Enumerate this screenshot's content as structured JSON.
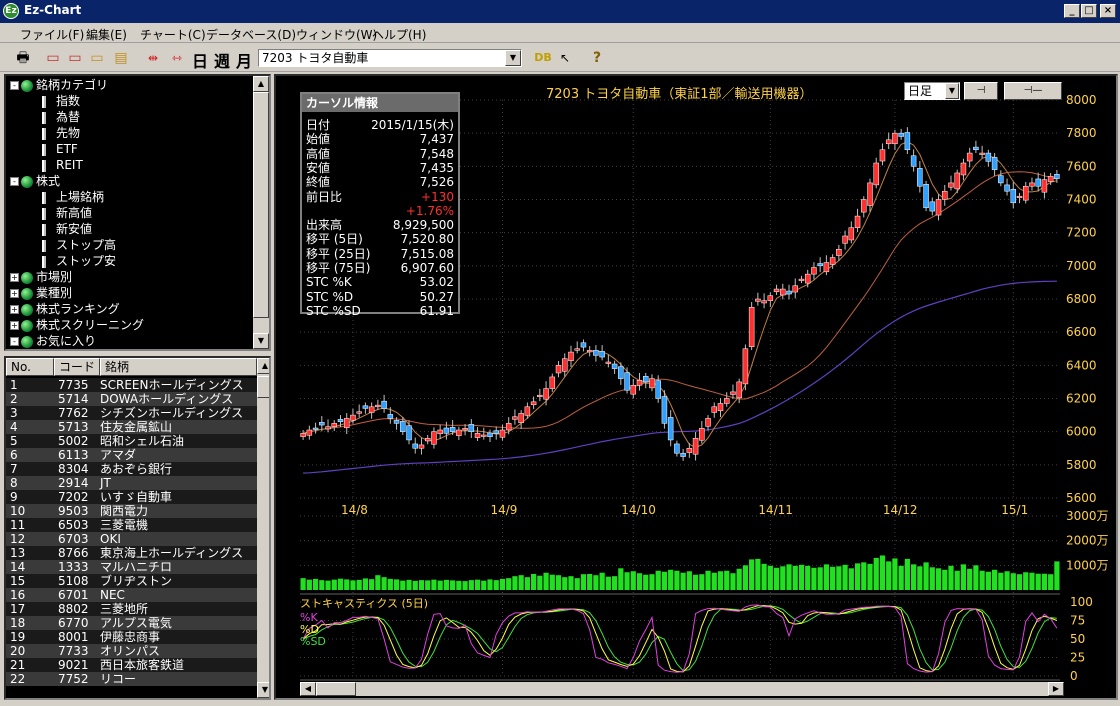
{
  "window": {
    "title": "Ez-Chart",
    "icon_letter": "Ez",
    "minimize": "_",
    "maximize": "□",
    "close": "×"
  },
  "menu": [
    "ファイル(F)",
    "編集(E)",
    "チャート(C)",
    "データベース(D)",
    "ウィンドウ(W)",
    "ヘルプ(H)"
  ],
  "toolbar": {
    "kanji_buttons": [
      "日",
      "週",
      "月"
    ],
    "stock_combo_value": "7203 トヨタ自動車",
    "icons": [
      "print-icon",
      "new-doc-icon",
      "copy-doc-icon",
      "paste-doc-icon",
      "notes-icon",
      "shrink-chart-icon",
      "expand-chart-icon",
      "db-icon",
      "pointer-help-icon",
      "help-icon"
    ]
  },
  "tree": [
    {
      "label": "銘柄カテゴリ",
      "level": 0,
      "expander": "-",
      "icon": "globe-icon"
    },
    {
      "label": "指数",
      "level": 1,
      "icon": "doc-icon"
    },
    {
      "label": "為替",
      "level": 1,
      "icon": "doc-icon"
    },
    {
      "label": "先物",
      "level": 1,
      "icon": "doc-icon"
    },
    {
      "label": "ETF",
      "level": 1,
      "icon": "doc-icon"
    },
    {
      "label": "REIT",
      "level": 1,
      "icon": "doc-icon"
    },
    {
      "label": "株式",
      "level": 0,
      "expander": "-",
      "icon": "globe-icon"
    },
    {
      "label": "上場銘柄",
      "level": 1,
      "icon": "doc-icon"
    },
    {
      "label": "新高値",
      "level": 1,
      "icon": "doc-icon"
    },
    {
      "label": "新安値",
      "level": 1,
      "icon": "doc-icon"
    },
    {
      "label": "ストップ高",
      "level": 1,
      "icon": "doc-icon"
    },
    {
      "label": "ストップ安",
      "level": 1,
      "icon": "doc-icon"
    },
    {
      "label": "市場別",
      "level": 0,
      "expander": "+",
      "icon": "globe-icon"
    },
    {
      "label": "業種別",
      "level": 0,
      "expander": "+",
      "icon": "globe-icon"
    },
    {
      "label": "株式ランキング",
      "level": 0,
      "expander": "+",
      "icon": "globe-icon"
    },
    {
      "label": "株式スクリーニング",
      "level": 0,
      "expander": "+",
      "icon": "globe-icon"
    },
    {
      "label": "お気に入り",
      "level": 0,
      "expander": "-",
      "icon": "globe-icon"
    }
  ],
  "list": {
    "headers": [
      "No.",
      "コード",
      "銘柄"
    ],
    "rows": [
      [
        "1",
        "7735",
        "SCREENホールディングス"
      ],
      [
        "2",
        "5714",
        "DOWAホールディングス"
      ],
      [
        "3",
        "7762",
        "シチズンホールディングス"
      ],
      [
        "4",
        "5713",
        "住友金属鉱山"
      ],
      [
        "5",
        "5002",
        "昭和シェル石油"
      ],
      [
        "6",
        "6113",
        "アマダ"
      ],
      [
        "7",
        "8304",
        "あおぞら銀行"
      ],
      [
        "8",
        "2914",
        "JT"
      ],
      [
        "9",
        "7202",
        "いすゞ自動車"
      ],
      [
        "10",
        "9503",
        "関西電力"
      ],
      [
        "11",
        "6503",
        "三菱電機"
      ],
      [
        "12",
        "6703",
        "OKI"
      ],
      [
        "13",
        "8766",
        "東京海上ホールディングス"
      ],
      [
        "14",
        "1333",
        "マルハニチロ"
      ],
      [
        "15",
        "5108",
        "ブリヂストン"
      ],
      [
        "16",
        "6701",
        "NEC"
      ],
      [
        "17",
        "8802",
        "三菱地所"
      ],
      [
        "18",
        "6770",
        "アルプス電気"
      ],
      [
        "19",
        "8001",
        "伊藤忠商事"
      ],
      [
        "20",
        "7733",
        "オリンパス"
      ],
      [
        "21",
        "9021",
        "西日本旅客鉄道"
      ],
      [
        "22",
        "7752",
        "リコー"
      ]
    ]
  },
  "chart": {
    "title": "7203 トヨタ自動車（東証1部／輸送用機器）",
    "period": "日足",
    "zoom_out_label": "⊣",
    "zoom_in_label": "⊣—",
    "price_ticks": [
      "8000",
      "7800",
      "7600",
      "7400",
      "7200",
      "7000",
      "6800",
      "6600",
      "6400",
      "6200",
      "6000",
      "5800",
      "5600"
    ],
    "date_ticks": [
      "14/8",
      "14/9",
      "14/10",
      "14/11",
      "14/12",
      "15/1"
    ],
    "volume_ticks": [
      "3000万",
      "2000万",
      "1000万"
    ],
    "stoch_title": "ストキャスティクス (5日)",
    "stoch_legend": [
      "%K",
      "%D",
      "%SD"
    ],
    "stoch_ticks": [
      "100",
      "75",
      "50",
      "25",
      "0"
    ],
    "colors": {
      "up": "#ff3030",
      "down": "#30a0ff",
      "ma_short": "#c08040",
      "ma_mid": "#c06040",
      "ma_long": "#6040c0",
      "volume": "#20e020",
      "k": "#e040e0",
      "d": "#ffff40",
      "sd": "#40e040",
      "grid": "#404040"
    }
  },
  "cursor_info": {
    "title": "カーソル情報",
    "rows": [
      [
        "日付",
        "2015/1/15(木)"
      ],
      [
        "始値",
        "7,437"
      ],
      [
        "高値",
        "7,548"
      ],
      [
        "安値",
        "7,435"
      ],
      [
        "終値",
        "7,526"
      ],
      [
        "前日比",
        "+130"
      ],
      [
        "",
        "+1.76%"
      ],
      [
        "出来高",
        "8,929,500"
      ],
      [
        "移平 (5日)",
        "7,520.80"
      ],
      [
        "移平 (25日)",
        "7,515.08"
      ],
      [
        "移平 (75日)",
        "6,907.60"
      ],
      [
        "STC %K",
        "53.02"
      ],
      [
        "STC %D",
        "50.27"
      ],
      [
        "STC %SD",
        "61.91"
      ]
    ]
  },
  "chart_data": {
    "type": "line",
    "title": "7203 トヨタ自動車（東証1部／輸送用機器）",
    "ylim": [
      5600,
      8000
    ],
    "x_ticks": [
      "14/8",
      "14/9",
      "14/10",
      "14/11",
      "14/12",
      "15/1"
    ],
    "close": [
      5990,
      6010,
      6020,
      6040,
      6030,
      6050,
      6060,
      6080,
      6100,
      6120,
      6140,
      6150,
      6160,
      6140,
      6080,
      6050,
      6000,
      5950,
      5900,
      5920,
      5960,
      6000,
      6010,
      5990,
      6000,
      6010,
      6020,
      6000,
      5990,
      5980,
      5970,
      5990,
      6010,
      6050,
      6090,
      6110,
      6150,
      6180,
      6220,
      6260,
      6330,
      6400,
      6440,
      6480,
      6500,
      6510,
      6490,
      6460,
      6450,
      6420,
      6380,
      6320,
      6250,
      6280,
      6310,
      6300,
      6320,
      6200,
      6050,
      5950,
      5870,
      5850,
      5900,
      5960,
      6020,
      6080,
      6150,
      6170,
      6200,
      6240,
      6300,
      6500,
      6750,
      6800,
      6790,
      6820,
      6860,
      6860,
      6830,
      6880,
      6920,
      6950,
      6990,
      7000,
      7020,
      7050,
      7100,
      7180,
      7230,
      7300,
      7400,
      7500,
      7620,
      7700,
      7760,
      7800,
      7780,
      7700,
      7600,
      7480,
      7350,
      7330,
      7400,
      7450,
      7500,
      7560,
      7620,
      7680,
      7700,
      7680,
      7630,
      7580,
      7500,
      7450,
      7380,
      7420,
      7480,
      7500,
      7480,
      7520,
      7540,
      7526
    ],
    "ma75": [
      5750,
      5752,
      5755,
      5758,
      5762,
      5766,
      5770,
      5774,
      5778,
      5782,
      5786,
      5790,
      5794,
      5798,
      5801,
      5804,
      5806,
      5808,
      5810,
      5811,
      5812,
      5814,
      5816,
      5818,
      5820,
      5822,
      5824,
      5826,
      5828,
      5830,
      5832,
      5834,
      5837,
      5840,
      5844,
      5848,
      5853,
      5858,
      5864,
      5870,
      5877,
      5884,
      5892,
      5900,
      5908,
      5916,
      5924,
      5932,
      5940,
      5947,
      5954,
      5960,
      5966,
      5972,
      5978,
      5984,
      5990,
      5994,
      5996,
      5998,
      6000,
      6001,
      6002,
      6004,
      6007,
      6011,
      6017,
      6024,
      6031,
      6040,
      6050,
      6063,
      6080,
      6098,
      6116,
      6135,
      6155,
      6176,
      6197,
      6220,
      6243,
      6267,
      6292,
      6318,
      6345,
      6373,
      6402,
      6432,
      6463,
      6495,
      6528,
      6560,
      6590,
      6618,
      6644,
      6668,
      6690,
      6710,
      6728,
      6744,
      6758,
      6770,
      6782,
      6793,
      6804,
      6815,
      6826,
      6837,
      6848,
      6859,
      6868,
      6876,
      6883,
      6889,
      6894,
      6898,
      6901,
      6903,
      6905,
      6906,
      6907,
      6907.6
    ],
    "volume_units": "万株",
    "volume": [
      480,
      420,
      450,
      400,
      380,
      420,
      460,
      430,
      390,
      410,
      470,
      440,
      600,
      520,
      450,
      430,
      380,
      410,
      370,
      400,
      390,
      420,
      380,
      410,
      390,
      370,
      360,
      400,
      420,
      380,
      430,
      400,
      450,
      480,
      560,
      600,
      520,
      650,
      580,
      700,
      620,
      600,
      520,
      560,
      480,
      640,
      650,
      600,
      700,
      540,
      560,
      880,
      720,
      760,
      680,
      620,
      640,
      780,
      740,
      820,
      780,
      700,
      760,
      620,
      640,
      780,
      700,
      760,
      780,
      680,
      860,
      1000,
      1240,
      1260,
      1060,
      980,
      900,
      960,
      1040,
      980,
      1020,
      980,
      900,
      920,
      1040,
      940,
      960,
      1020,
      880,
      1080,
      1120,
      1060,
      1300,
      1400,
      1160,
      1280,
      980,
      1260,
      1040,
      960,
      1120,
      920,
      880,
      820,
      980,
      780,
      1040,
      860,
      1000,
      780,
      740,
      820,
      700,
      760,
      680,
      640,
      720,
      700,
      660,
      660,
      640,
      1160
    ],
    "stoch_ylim": [
      0,
      100
    ]
  }
}
